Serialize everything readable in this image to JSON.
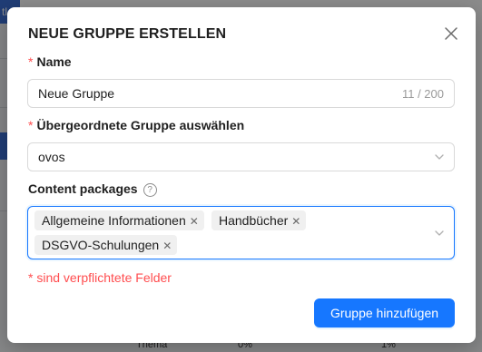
{
  "background": {
    "corner_label": "tl",
    "row": {
      "col1": "Thema",
      "col2": "0%",
      "col3": "1%"
    }
  },
  "modal": {
    "title": "NEUE GRUPPE ERSTELLEN",
    "close_icon": "close-icon",
    "required_marker": "*",
    "name_field": {
      "label": "Name",
      "value": "Neue Gruppe",
      "counter": "11 / 200"
    },
    "parent_field": {
      "label": "Übergeordnete Gruppe auswählen",
      "value": "ovos"
    },
    "content_packages": {
      "label": "Content packages",
      "help_icon": "question-circle-icon",
      "tags": [
        "Allgemeine Informationen",
        "Handbücher",
        "DSGVO-Schulungen"
      ]
    },
    "required_hint": "* sind verpflichtete Felder",
    "submit_label": "Gruppe hinzufügen"
  },
  "colors": {
    "primary": "#1677ff",
    "required": "#ff4d4f",
    "tag_bg": "#f0f0f0"
  }
}
